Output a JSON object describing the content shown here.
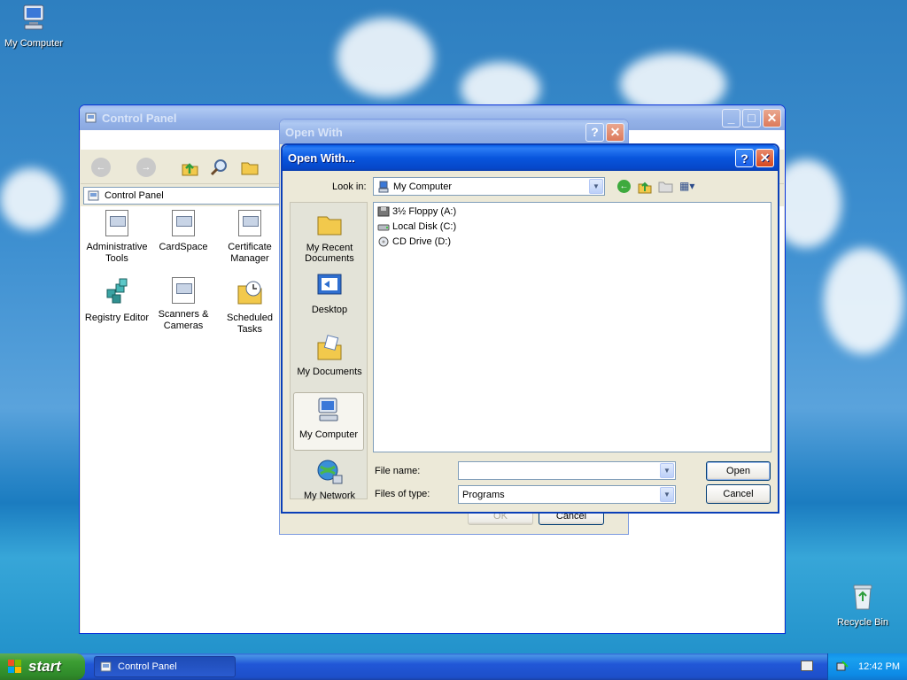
{
  "desktop": {
    "icons": [
      {
        "label": "My Computer"
      },
      {
        "label": "Recycle Bin"
      }
    ]
  },
  "control_panel": {
    "title": "Control Panel",
    "address": "Control Panel",
    "items": [
      {
        "label": "Administrative Tools"
      },
      {
        "label": "CardSpace"
      },
      {
        "label": "Certificate Manager"
      },
      {
        "label": "Registry Editor"
      },
      {
        "label": "Scanners & Cameras"
      },
      {
        "label": "Scheduled Tasks"
      }
    ]
  },
  "open_with_back": {
    "title": "Open With",
    "ok_label": "OK",
    "cancel_label": "Cancel"
  },
  "open_dialog": {
    "title": "Open With...",
    "look_in_label": "Look in:",
    "look_in_value": "My Computer",
    "places": [
      {
        "label": "My Recent Documents"
      },
      {
        "label": "Desktop"
      },
      {
        "label": "My Documents"
      },
      {
        "label": "My Computer"
      },
      {
        "label": "My Network"
      }
    ],
    "files": [
      {
        "name": "3½ Floppy (A:)",
        "icon": "floppy-drive-icon"
      },
      {
        "name": "Local Disk (C:)",
        "icon": "hard-disk-icon"
      },
      {
        "name": "CD Drive (D:)",
        "icon": "cd-drive-icon"
      }
    ],
    "file_name_label": "File name:",
    "file_name_value": "",
    "files_of_type_label": "Files of type:",
    "files_of_type_value": "Programs",
    "open_label": "Open",
    "cancel_label": "Cancel"
  },
  "taskbar": {
    "start_label": "start",
    "task_label": "Control Panel",
    "clock": "12:42 PM"
  }
}
